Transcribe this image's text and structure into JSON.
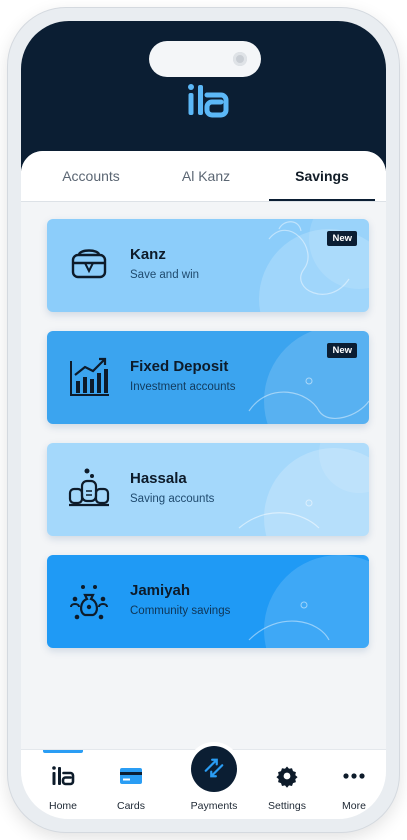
{
  "header": {
    "logo_text": "ila"
  },
  "tabs": [
    {
      "label": "Accounts",
      "active": false
    },
    {
      "label": "Al Kanz",
      "active": false
    },
    {
      "label": "Savings",
      "active": true
    }
  ],
  "cards": [
    {
      "title": "Kanz",
      "subtitle": "Save and win",
      "badge": "New",
      "icon": "treasure-chest-icon",
      "bg": "#8ccdfa",
      "subtitle_color": "#1f4a6e"
    },
    {
      "title": "Fixed Deposit",
      "subtitle": "Investment accounts",
      "badge": "New",
      "icon": "growth-chart-icon",
      "bg": "#3ba4ef",
      "subtitle_color": "#123a5c"
    },
    {
      "title": "Hassala",
      "subtitle": "Saving accounts",
      "badge": "",
      "icon": "coin-jars-icon",
      "bg": "#a4d8fb",
      "subtitle_color": "#1f4a6e"
    },
    {
      "title": "Jamiyah",
      "subtitle": "Community savings",
      "badge": "",
      "icon": "money-bag-group-icon",
      "bg": "#1f9af5",
      "subtitle_color": "#0f3556"
    }
  ],
  "bottom_nav": [
    {
      "label": "Home",
      "icon": "ila-logo-icon",
      "active": true
    },
    {
      "label": "Cards",
      "icon": "card-icon",
      "active": false
    },
    {
      "label": "Payments",
      "icon": "transfer-arrows-icon",
      "active": false
    },
    {
      "label": "Settings",
      "icon": "gear-icon",
      "active": false
    },
    {
      "label": "More",
      "icon": "more-dots-icon",
      "active": false
    }
  ],
  "colors": {
    "header_bg": "#0b1e33",
    "accent": "#2a9df4",
    "badge_bg": "#0b1e33"
  }
}
